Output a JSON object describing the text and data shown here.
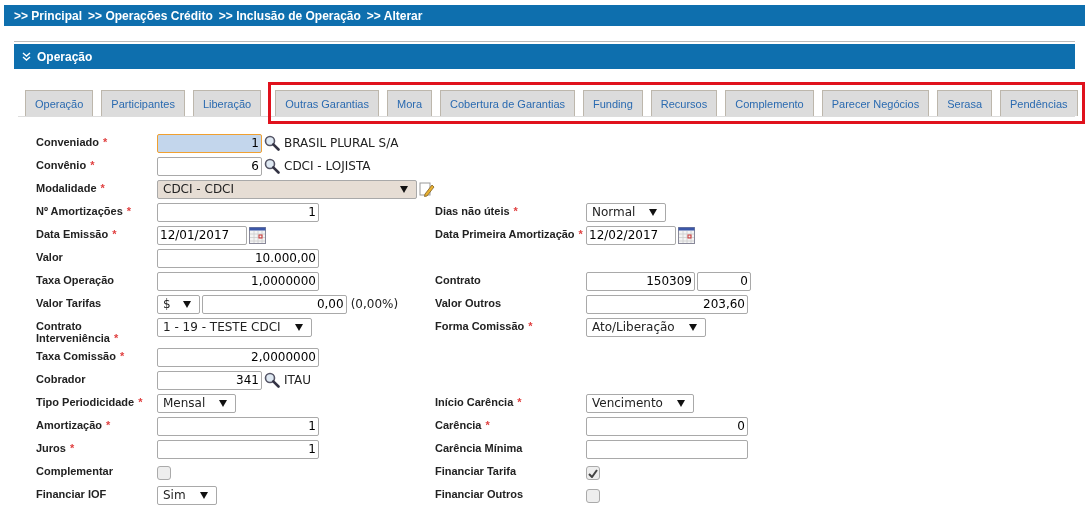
{
  "breadcrumb": {
    "separator": ">>",
    "items": [
      "Principal",
      "Operações Crédito",
      "Inclusão de Operação",
      "Alterar"
    ]
  },
  "section": {
    "title": "Operação",
    "expanded": true
  },
  "tab_groups": [
    {
      "highlighted": false,
      "tabs": [
        {
          "label": "Operação",
          "selected": false
        },
        {
          "label": "Participantes",
          "selected": false
        },
        {
          "label": "Liberação",
          "selected": false
        }
      ]
    },
    {
      "highlighted": true,
      "tabs": [
        {
          "label": "Outras Garantias",
          "selected": false
        },
        {
          "label": "Mora",
          "selected": false
        },
        {
          "label": "Cobertura de Garantias",
          "selected": false
        },
        {
          "label": "Funding",
          "selected": false
        },
        {
          "label": "Recursos",
          "selected": false
        },
        {
          "label": "Complemento",
          "selected": false
        },
        {
          "label": "Parecer Negócios",
          "selected": false
        },
        {
          "label": "Serasa",
          "selected": false
        },
        {
          "label": "Pendências",
          "selected": false
        }
      ]
    }
  ],
  "rows": [
    {
      "left": {
        "label": "Conveniado",
        "required_mark": "*",
        "kind": "lookup",
        "value": "1",
        "description": "BRASIL PLURAL S/A",
        "focused": true
      }
    },
    {
      "left": {
        "label": "Convênio",
        "required_mark": "*",
        "kind": "lookup",
        "value": "6",
        "description": "CDCI - LOJISTA",
        "focused": false
      }
    },
    {
      "left": {
        "label": "Modalidade",
        "required_mark": "*",
        "kind": "combo",
        "value": "CDCI - CDCI"
      }
    },
    {
      "left": {
        "label": "Nº Amortizações",
        "required_mark": "*",
        "kind": "text",
        "value": "1"
      },
      "right": {
        "label": "Dias não úteis",
        "required_mark": "*",
        "kind": "select",
        "value": "Normal"
      }
    },
    {
      "left": {
        "label": "Data Emissão",
        "required_mark": "*",
        "kind": "date",
        "value": "12/01/2017"
      },
      "right": {
        "label": "Data Primeira Amortização",
        "required_mark": "*",
        "kind": "date",
        "value": "12/02/2017"
      }
    },
    {
      "left": {
        "label": "Valor",
        "kind": "text",
        "value": "10.000,00"
      }
    },
    {
      "left": {
        "label": "Taxa Operação",
        "kind": "text",
        "value": "1,0000000"
      },
      "right": {
        "label": "Contrato",
        "kind": "pair",
        "value": "150309",
        "value_2": "0"
      }
    },
    {
      "left": {
        "label": "Valor Tarifas",
        "kind": "currency",
        "unit": "$",
        "value": "0,00",
        "note": "(0,00%)"
      },
      "right": {
        "label": "Valor Outros",
        "kind": "text",
        "value": "203,60"
      }
    },
    {
      "left": {
        "label": "Contrato Interveniência",
        "required_mark": "*",
        "kind": "select",
        "value": "1 - 19 - TESTE CDCI"
      },
      "right": {
        "label": "Forma Comissão",
        "required_mark": "*",
        "kind": "select",
        "value": "Ato/Liberação"
      }
    },
    {
      "left": {
        "label": "Taxa Comissão",
        "required_mark": "*",
        "kind": "text",
        "value": "2,0000000"
      }
    },
    {
      "left": {
        "label": "Cobrador",
        "kind": "lookup",
        "value": "341",
        "description": "ITAU",
        "focused": false
      }
    },
    {
      "left": {
        "label": "Tipo Periodicidade",
        "required_mark": "*",
        "kind": "select",
        "value": "Mensal"
      },
      "right": {
        "label": "Início Carência",
        "required_mark": "*",
        "kind": "select",
        "value": "Vencimento"
      }
    },
    {
      "left": {
        "label": "Amortização",
        "required_mark": "*",
        "kind": "text",
        "value": "1"
      },
      "right": {
        "label": "Carência",
        "required_mark": "*",
        "kind": "text",
        "value": "0"
      }
    },
    {
      "left": {
        "label": "Juros",
        "required_mark": "*",
        "kind": "text",
        "value": "1"
      },
      "right": {
        "label": "Carência Mínima",
        "kind": "text"
      }
    },
    {
      "left": {
        "label": "Complementar",
        "kind": "checkbox",
        "checked": false
      },
      "right": {
        "label": "Financiar Tarifa",
        "kind": "checkbox",
        "checked": true
      }
    },
    {
      "left": {
        "label": "Financiar IOF",
        "kind": "select",
        "value": "Sim"
      },
      "right": {
        "label": "Financiar Outros",
        "kind": "checkbox",
        "checked": false
      }
    }
  ]
}
